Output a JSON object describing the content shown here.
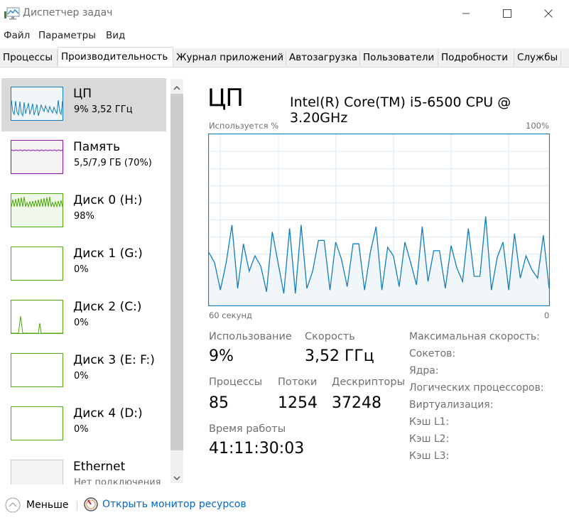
{
  "window": {
    "title": "Диспетчер задач",
    "icon": "task-manager-icon",
    "controls": {
      "minimize": "minimize-icon",
      "maximize": "maximize-icon",
      "close": "close-icon"
    }
  },
  "menu": [
    "Файл",
    "Параметры",
    "Вид"
  ],
  "tabs": [
    {
      "label": "Процессы",
      "active": false
    },
    {
      "label": "Производительность",
      "active": true
    },
    {
      "label": "Журнал приложений",
      "active": false
    },
    {
      "label": "Автозагрузка",
      "active": false
    },
    {
      "label": "Пользователи",
      "active": false
    },
    {
      "label": "Подробности",
      "active": false
    },
    {
      "label": "Службы",
      "active": false
    }
  ],
  "sidebar": {
    "items": [
      {
        "title": "ЦП",
        "subtitle": "9% 3,52 ГГц",
        "selected": true,
        "color": "#117dbb",
        "fill": "#f1f6fa"
      },
      {
        "title": "Память",
        "subtitle": "5,5/7,9 ГБ (70%)",
        "selected": false,
        "color": "#8b12ae",
        "fill": "#f4f2f4"
      },
      {
        "title": "Диск 0 (H:)",
        "subtitle": "98%",
        "selected": false,
        "color": "#4da60c",
        "fill": "#eff7e9"
      },
      {
        "title": "Диск 1 (G:)",
        "subtitle": "0%",
        "selected": false,
        "color": "#4da60c",
        "fill": "#ffffff"
      },
      {
        "title": "Диск 2 (C:)",
        "subtitle": "0%",
        "selected": false,
        "color": "#4da60c",
        "fill": "#ffffff"
      },
      {
        "title": "Диск 3 (E: F:)",
        "subtitle": "0%",
        "selected": false,
        "color": "#4da60c",
        "fill": "#ffffff"
      },
      {
        "title": "Диск 4 (D:)",
        "subtitle": "0%",
        "selected": false,
        "color": "#4da60c",
        "fill": "#ffffff"
      },
      {
        "title": "Ethernet",
        "subtitle": "Нет подключения",
        "selected": false,
        "color": "#c8c8c8",
        "fill": "#f4f4f4"
      }
    ]
  },
  "main": {
    "title": "ЦП",
    "cpu_model": "Intel(R) Core(TM) i5-6500 CPU @ 3.20GHz",
    "graph": {
      "ylabel": "Используется %",
      "ymax_label": "100%",
      "xleft_label": "60 секунд",
      "xright_label": "0",
      "line_color": "#117dbb",
      "fill_color": "#f1f6fa",
      "grid_color": "#d9eaf4"
    },
    "stats": {
      "usage_label": "Использование",
      "usage_value": "9%",
      "speed_label": "Скорость",
      "speed_value": "3,52 ГГц",
      "processes_label": "Процессы",
      "processes_value": "85",
      "threads_label": "Потоки",
      "threads_value": "1254",
      "handles_label": "Дескрипторы",
      "handles_value": "37248",
      "uptime_label": "Время работы",
      "uptime_value": "41:11:30:03"
    },
    "specs": [
      "Максимальная скорость:",
      "Сокетов:",
      "Ядра:",
      "Логических процессоров:",
      "Виртуализация:",
      "Кэш L1:",
      "Кэш L2:",
      "Кэш L3:"
    ]
  },
  "footer": {
    "fewer_details": "Меньше",
    "open_resource_monitor": "Открыть монитор ресурсов"
  },
  "chart_data": {
    "type": "area",
    "title": "ЦП",
    "ylabel": "Используется %",
    "xlabel": "60 секунд",
    "ylim": [
      0,
      100
    ],
    "xlim": [
      60,
      0
    ],
    "grid": true,
    "series": [
      {
        "name": "CPU usage %",
        "values": [
          31,
          25,
          9,
          25,
          47,
          10,
          36,
          20,
          29,
          23,
          8,
          43,
          25,
          7,
          45,
          7,
          47,
          10,
          20,
          38,
          38,
          9,
          37,
          27,
          11,
          36,
          36,
          9,
          31,
          46,
          9,
          34,
          29,
          11,
          37,
          25,
          12,
          46,
          14,
          32,
          32,
          10,
          35,
          22,
          14,
          45,
          17,
          17,
          52,
          9,
          28,
          37,
          9,
          42,
          16,
          29,
          21,
          16,
          41,
          10
        ]
      }
    ]
  }
}
